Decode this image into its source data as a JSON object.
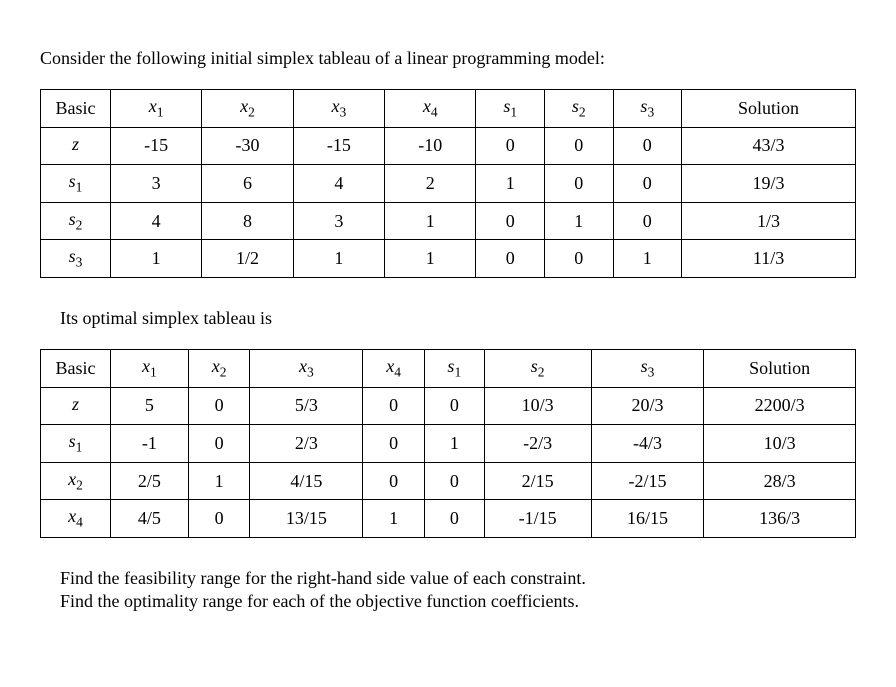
{
  "intro": "Consider the following initial simplex tableau of a linear programming model:",
  "subtitle": "Its optimal simplex tableau is",
  "headers": {
    "basic": "Basic",
    "x1_base": "x",
    "x1_sub": "1",
    "x2_base": "x",
    "x2_sub": "2",
    "x3_base": "x",
    "x3_sub": "3",
    "x4_base": "x",
    "x4_sub": "4",
    "s1_base": "s",
    "s1_sub": "1",
    "s2_base": "s",
    "s2_sub": "2",
    "s3_base": "s",
    "s3_sub": "3",
    "solution": "Solution"
  },
  "table1": {
    "rows": [
      {
        "label_base": "z",
        "label_sub": "",
        "x1": "-15",
        "x2": "-30",
        "x3": "-15",
        "x4": "-10",
        "s1": "0",
        "s2": "0",
        "s3": "0",
        "solution": "43/3"
      },
      {
        "label_base": "s",
        "label_sub": "1",
        "x1": "3",
        "x2": "6",
        "x3": "4",
        "x4": "2",
        "s1": "1",
        "s2": "0",
        "s3": "0",
        "solution": "19/3"
      },
      {
        "label_base": "s",
        "label_sub": "2",
        "x1": "4",
        "x2": "8",
        "x3": "3",
        "x4": "1",
        "s1": "0",
        "s2": "1",
        "s3": "0",
        "solution": "1/3"
      },
      {
        "label_base": "s",
        "label_sub": "3",
        "x1": "1",
        "x2": "1/2",
        "x3": "1",
        "x4": "1",
        "s1": "0",
        "s2": "0",
        "s3": "1",
        "solution": "11/3"
      }
    ]
  },
  "table2": {
    "rows": [
      {
        "label_base": "z",
        "label_sub": "",
        "x1": "5",
        "x2": "0",
        "x3": "5/3",
        "x4": "0",
        "s1": "0",
        "s2": "10/3",
        "s3": "20/3",
        "solution": "2200/3"
      },
      {
        "label_base": "s",
        "label_sub": "1",
        "x1": "-1",
        "x2": "0",
        "x3": "2/3",
        "x4": "0",
        "s1": "1",
        "s2": "-2/3",
        "s3": "-4/3",
        "solution": "10/3"
      },
      {
        "label_base": "x",
        "label_sub": "2",
        "x1": "2/5",
        "x2": "1",
        "x3": "4/15",
        "x4": "0",
        "s1": "0",
        "s2": "2/15",
        "s3": "-2/15",
        "solution": "28/3"
      },
      {
        "label_base": "x",
        "label_sub": "4",
        "x1": "4/5",
        "x2": "0",
        "x3": "13/15",
        "x4": "1",
        "s1": "0",
        "s2": "-1/15",
        "s3": "16/15",
        "solution": "136/3"
      }
    ]
  },
  "questions": {
    "q1": "Find the feasibility range for the right-hand side value of each constraint.",
    "q2": "Find the optimality range for each of the objective function coefficients."
  },
  "chart_data": [
    {
      "type": "table",
      "title": "Initial simplex tableau",
      "columns": [
        "Basic",
        "x1",
        "x2",
        "x3",
        "x4",
        "s1",
        "s2",
        "s3",
        "Solution"
      ],
      "rows": [
        [
          "z",
          -15,
          -30,
          -15,
          -10,
          0,
          0,
          0,
          "43/3"
        ],
        [
          "s1",
          3,
          6,
          4,
          2,
          1,
          0,
          0,
          "19/3"
        ],
        [
          "s2",
          4,
          8,
          3,
          1,
          0,
          1,
          0,
          "1/3"
        ],
        [
          "s3",
          1,
          "1/2",
          1,
          1,
          0,
          0,
          1,
          "11/3"
        ]
      ]
    },
    {
      "type": "table",
      "title": "Optimal simplex tableau",
      "columns": [
        "Basic",
        "x1",
        "x2",
        "x3",
        "x4",
        "s1",
        "s2",
        "s3",
        "Solution"
      ],
      "rows": [
        [
          "z",
          5,
          0,
          "5/3",
          0,
          0,
          "10/3",
          "20/3",
          "2200/3"
        ],
        [
          "s1",
          -1,
          0,
          "2/3",
          0,
          1,
          "-2/3",
          "-4/3",
          "10/3"
        ],
        [
          "x2",
          "2/5",
          1,
          "4/15",
          0,
          0,
          "2/15",
          "-2/15",
          "28/3"
        ],
        [
          "x4",
          "4/5",
          0,
          "13/15",
          1,
          0,
          "-1/15",
          "16/15",
          "136/3"
        ]
      ]
    }
  ]
}
